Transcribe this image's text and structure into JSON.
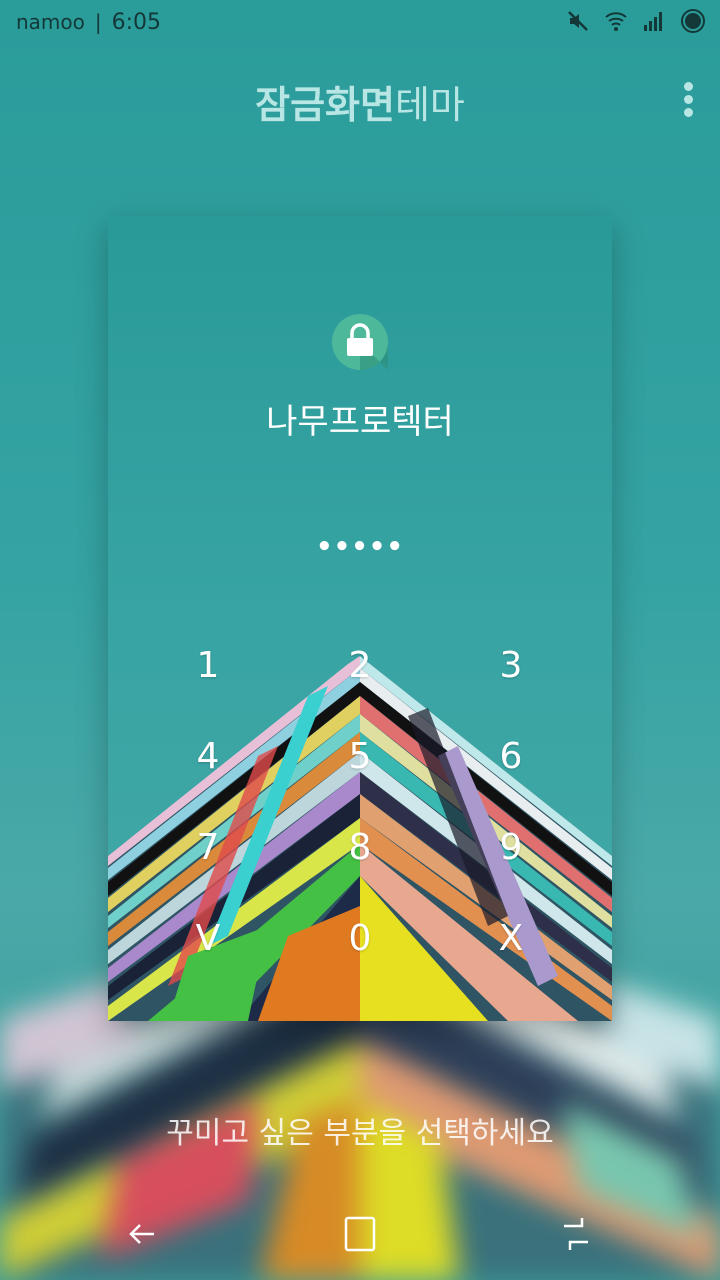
{
  "status_bar": {
    "carrier": "namoo",
    "separator": "|",
    "time": "6:05",
    "icons": [
      "mute-icon",
      "wifi-icon",
      "signal-icon",
      "record-icon"
    ]
  },
  "header": {
    "title_bold": "잠금화면",
    "title_regular": "테마",
    "menu_icon": "more-vert-icon"
  },
  "preview": {
    "lock_icon": "lock-icon",
    "app_name": "나무프로텍터",
    "pin_mask": "•••••",
    "keys": [
      "1",
      "2",
      "3",
      "4",
      "5",
      "6",
      "7",
      "8",
      "9",
      "V",
      "0",
      "X"
    ]
  },
  "hint": "꾸미고 싶은 부분을 선택하세요",
  "nav": {
    "back_icon": "back-icon",
    "home_icon": "home-icon",
    "recents_icon": "recents-icon"
  },
  "colors": {
    "background": "#35a3a3",
    "header_text": "#b8e6e4",
    "lock_circle": "#4db89a"
  }
}
